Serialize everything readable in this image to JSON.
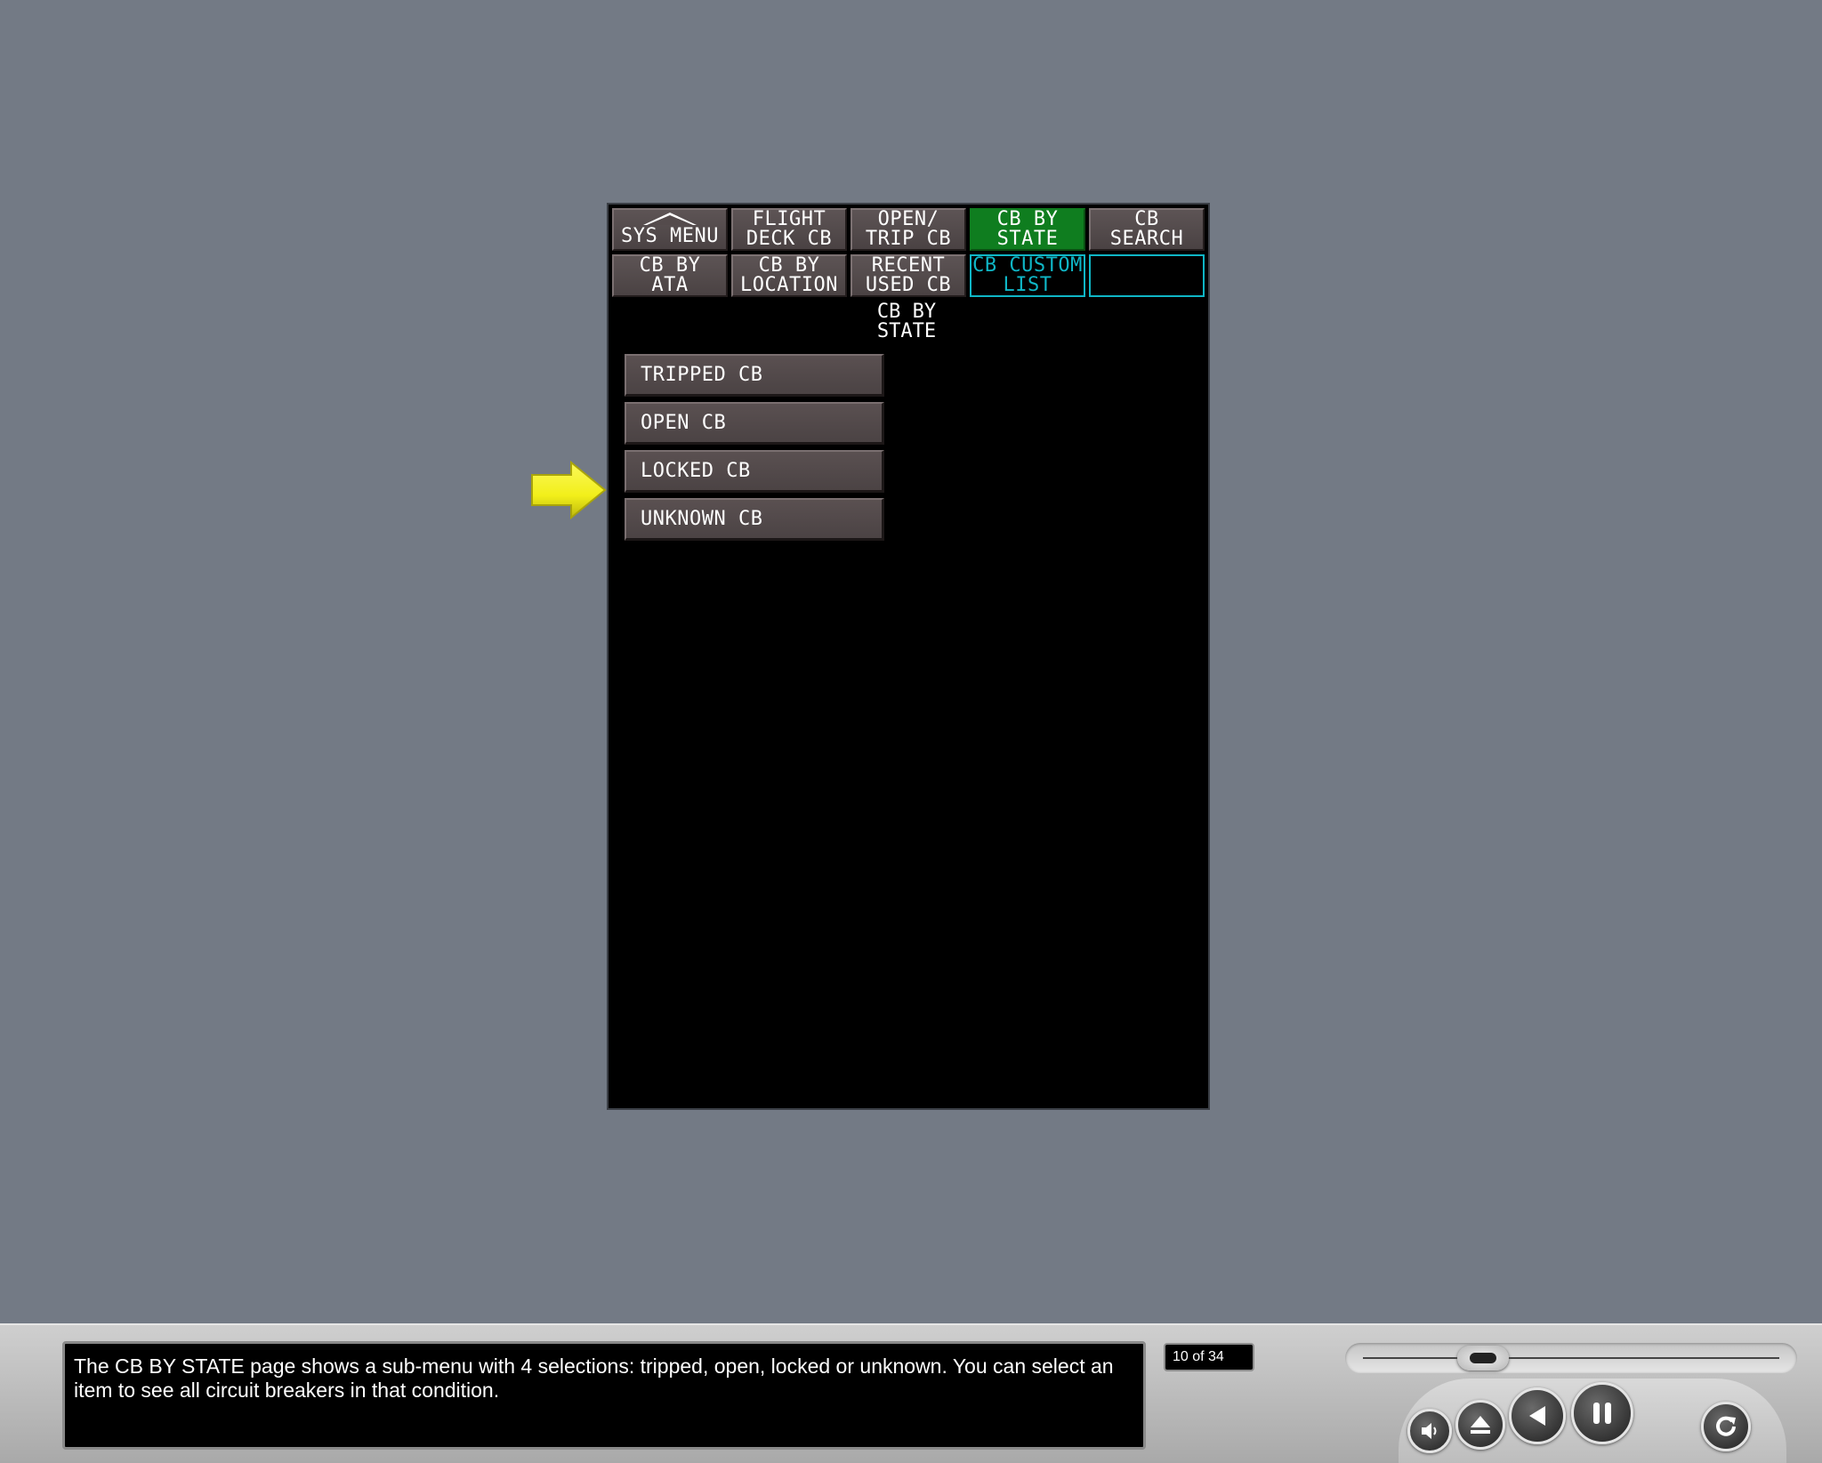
{
  "display": {
    "tabs_row1": [
      {
        "lines": [
          "",
          "SYS MENU"
        ],
        "state": "normal"
      },
      {
        "lines": [
          "FLIGHT",
          "DECK CB"
        ],
        "state": "normal"
      },
      {
        "lines": [
          "OPEN/",
          "TRIP CB"
        ],
        "state": "normal"
      },
      {
        "lines": [
          "CB BY",
          "STATE"
        ],
        "state": "active"
      },
      {
        "lines": [
          "CB",
          "SEARCH"
        ],
        "state": "normal"
      }
    ],
    "tabs_row2": [
      {
        "lines": [
          "CB BY",
          "ATA"
        ],
        "state": "normal"
      },
      {
        "lines": [
          "CB BY",
          "LOCATION"
        ],
        "state": "normal"
      },
      {
        "lines": [
          "RECENT",
          "USED CB"
        ],
        "state": "normal"
      },
      {
        "lines": [
          "CB CUSTOM",
          "LIST"
        ],
        "state": "cyan"
      },
      {
        "lines": [
          "",
          ""
        ],
        "state": "cyan"
      }
    ],
    "page_title": [
      "CB BY",
      "STATE"
    ],
    "menu_items": [
      "TRIPPED CB",
      "OPEN CB",
      "LOCKED CB",
      "UNKNOWN CB"
    ]
  },
  "player": {
    "caption": "The CB BY STATE page shows a sub-menu with 4 selections: tripped, open, locked or unknown. You can select an item to see all circuit breakers in that condition.",
    "counter": "10 of 34",
    "progress_fraction": 0.27,
    "controls": [
      "volume-icon",
      "eject-icon",
      "rewind-icon",
      "pause-icon",
      "replay-icon"
    ]
  },
  "colors": {
    "background": "#737a85",
    "active_tab": "#0f7d1f",
    "cyan_tab": "#0fb6c6",
    "arrow": "#f2ef1a"
  }
}
